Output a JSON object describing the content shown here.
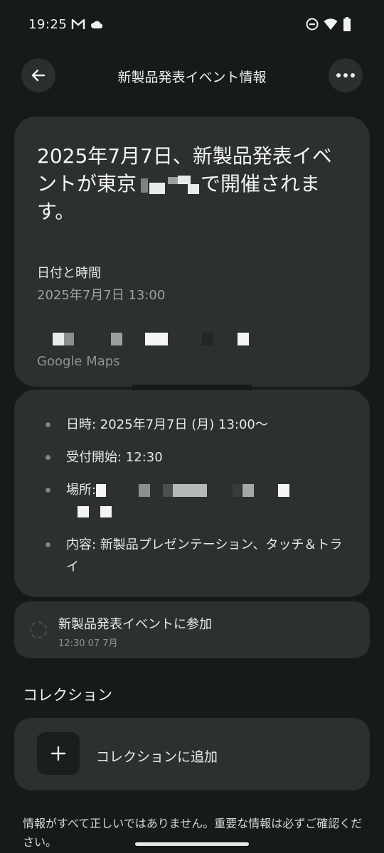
{
  "status_bar": {
    "time": "19:25",
    "icons": [
      "gmail-icon",
      "cloud-icon",
      "do-not-disturb-icon",
      "wifi-icon",
      "battery-icon"
    ]
  },
  "app_bar": {
    "title": "新製品発表イベント情報",
    "back_icon": "arrow-back-icon",
    "more_icon": "more-horizontal-icon"
  },
  "event": {
    "headline_part1": "2025年7月7日、新製品発表イベントが東京",
    "headline_part2": "で開催されます。",
    "datetime_label": "日付と時間",
    "datetime_value": "2025年7月7日 13:00",
    "maps_label": "Google Maps"
  },
  "details": [
    {
      "text": "日時: 2025年7月7日 (月) 13:00〜"
    },
    {
      "text": "受付開始: 12:30"
    },
    {
      "text": "場所:"
    },
    {
      "text": "内容: 新製品プレゼンテーション、タッチ＆トライ"
    }
  ],
  "task": {
    "title": "新製品発表イベントに参加",
    "subtitle": "12:30 07 7月"
  },
  "collection": {
    "section_title": "コレクション",
    "add_label": "コレクションに追加",
    "add_icon": "plus-icon"
  },
  "disclaimer": "情報がすべて正しいではありません。重要な情報は必ずご確認ください。",
  "colors": {
    "background": "#161a19",
    "card": "#2c302f",
    "text_primary": "#e8eae8",
    "text_secondary": "#9da3a1"
  }
}
